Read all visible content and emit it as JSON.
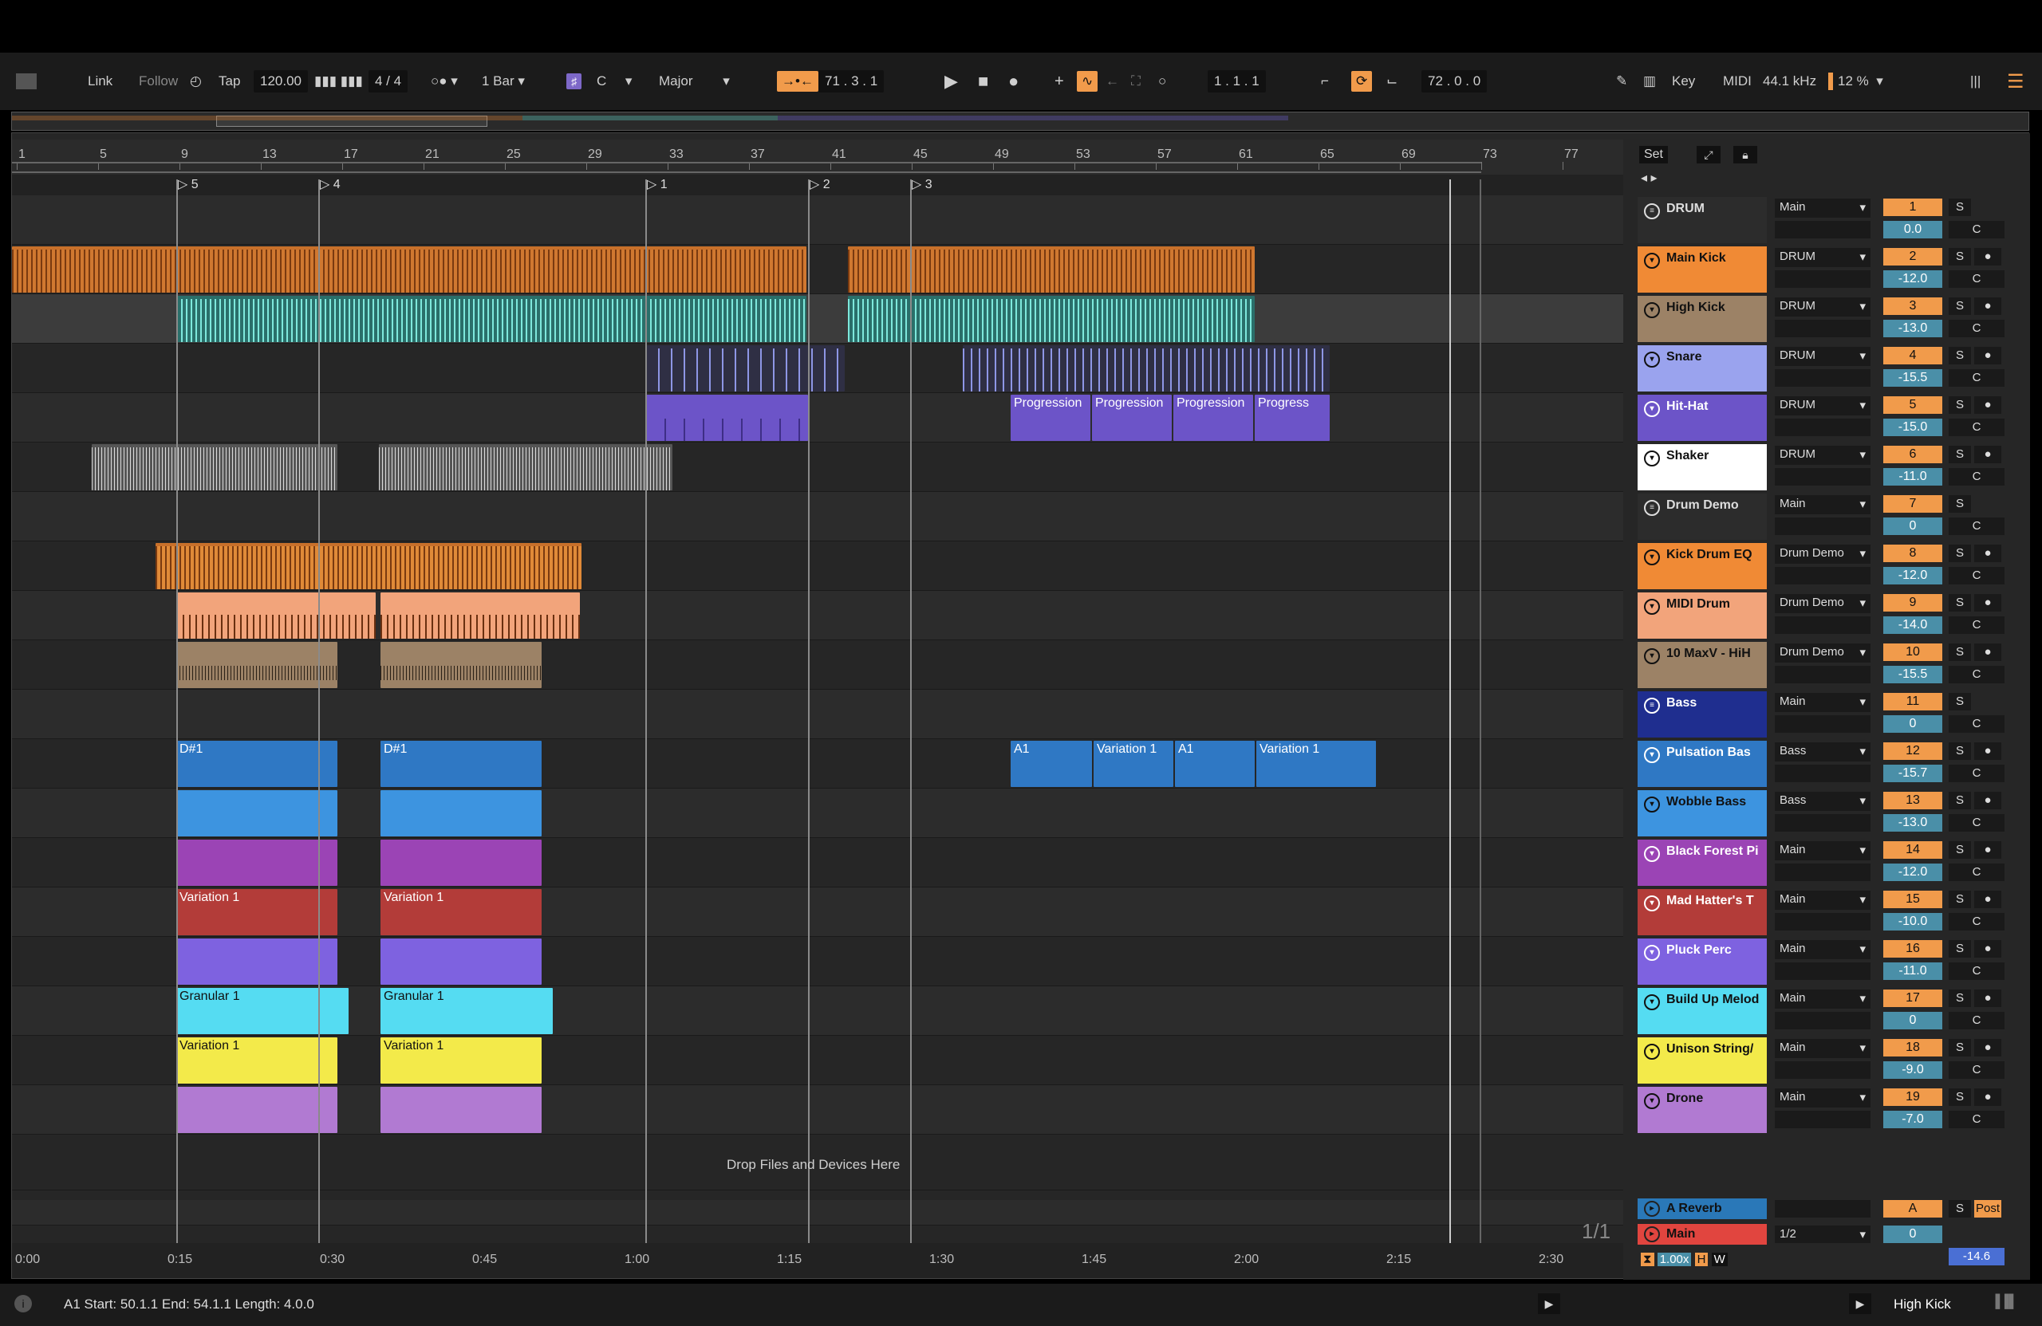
{
  "toolbar": {
    "link": "Link",
    "follow": "Follow",
    "tap": "Tap",
    "tempo": "120.00",
    "signature": "4 / 4",
    "quantize": "1 Bar",
    "key_root": "C",
    "scale": "Major",
    "position": "71 .  3 .  1",
    "loop_start": "1 .  1 .  1",
    "loop_length": "72 .  0 .  0",
    "key": "Key",
    "midi": "MIDI",
    "sample_rate": "44.1 kHz",
    "cpu": "12 %"
  },
  "ruler": {
    "bars": [
      "1",
      "5",
      "9",
      "13",
      "17",
      "21",
      "25",
      "29",
      "33",
      "37",
      "41",
      "45",
      "49",
      "53",
      "57",
      "61",
      "65",
      "69",
      "73",
      "77"
    ]
  },
  "locators": [
    "5",
    "4",
    "1",
    "2",
    "3"
  ],
  "clips": {
    "prog1": "Progression",
    "prog2": "Progression",
    "prog3": "Progression",
    "prog4": "Progress",
    "d1": "D#1",
    "d2": "D#1",
    "a1": "A1",
    "var_a": "Variation 1",
    "a1b": "A1",
    "var_b": "Variation 1",
    "var1": "Variation 1",
    "var2": "Variation 1",
    "gran1": "Granular 1",
    "gran2": "Granular 1",
    "var3": "Variation 1",
    "var4": "Variation 1"
  },
  "drop_text": "Drop Files and Devices Here",
  "time_ticks": [
    "0:00",
    "0:15",
    "0:30",
    "0:45",
    "1:00",
    "1:15",
    "1:30",
    "1:45",
    "2:00",
    "2:15",
    "2:30"
  ],
  "mixer": {
    "set": "Set",
    "tracks": [
      {
        "name": "DRUM",
        "route": "Main",
        "num": "1",
        "vol": "0.0",
        "color": "#2c2c2c",
        "group": true
      },
      {
        "name": "Main Kick",
        "route": "DRUM",
        "num": "2",
        "vol": "-12.0",
        "color": "#f08a35"
      },
      {
        "name": "High Kick",
        "route": "DRUM",
        "num": "3",
        "vol": "-13.0",
        "color": "#9c8266"
      },
      {
        "name": "Snare",
        "route": "DRUM",
        "num": "4",
        "vol": "-15.5",
        "color": "#9aa3ee"
      },
      {
        "name": "Hit-Hat",
        "route": "DRUM",
        "num": "5",
        "vol": "-15.0",
        "color": "#6c54c8"
      },
      {
        "name": "Shaker",
        "route": "DRUM",
        "num": "6",
        "vol": "-11.0",
        "color": "#ffffff"
      },
      {
        "name": "Drum Demo",
        "route": "Main",
        "num": "7",
        "vol": "0",
        "color": "#2c2c2c",
        "group": true
      },
      {
        "name": "Kick Drum EQ",
        "route": "Drum Demo",
        "num": "8",
        "vol": "-12.0",
        "color": "#f08a35"
      },
      {
        "name": "MIDI Drum",
        "route": "Drum Demo",
        "num": "9",
        "vol": "-14.0",
        "color": "#f2a47b"
      },
      {
        "name": "10 MaxV - HiH",
        "route": "Drum Demo",
        "num": "10",
        "vol": "-15.5",
        "color": "#9c8266"
      },
      {
        "name": "Bass",
        "route": "Main",
        "num": "11",
        "vol": "0",
        "color": "#1f2e8f",
        "group": true
      },
      {
        "name": "Pulsation Bas",
        "route": "Bass",
        "num": "12",
        "vol": "-15.7",
        "color": "#2f78c4"
      },
      {
        "name": "Wobble Bass",
        "route": "Bass",
        "num": "13",
        "vol": "-13.0",
        "color": "#3d94e0"
      },
      {
        "name": "Black Forest Pi",
        "route": "Main",
        "num": "14",
        "vol": "-12.0",
        "color": "#9b44b5"
      },
      {
        "name": "Mad Hatter's T",
        "route": "Main",
        "num": "15",
        "vol": "-10.0",
        "color": "#b33c39"
      },
      {
        "name": "Pluck Perc",
        "route": "Main",
        "num": "16",
        "vol": "-11.0",
        "color": "#7e62e0"
      },
      {
        "name": "Build Up Melod",
        "route": "Main",
        "num": "17",
        "vol": "0",
        "color": "#55dcf2"
      },
      {
        "name": "Unison String/",
        "route": "Main",
        "num": "18",
        "vol": "-9.0",
        "color": "#f3ea4a"
      },
      {
        "name": "Drone",
        "route": "Main",
        "num": "19",
        "vol": "-7.0",
        "color": "#b17ad2"
      }
    ],
    "return_name": "A Reverb",
    "return_letter": "A",
    "return_post": "Post",
    "master_name": "Main",
    "master_route": "1/2",
    "master_vol": "0",
    "master_pan": "-14.6",
    "page": "1/1",
    "zoom": "1.00x"
  },
  "status": {
    "clip_info": "A1  Start: 50.1.1  End: 54.1.1  Length: 4.0.0",
    "selected_track": "High Kick"
  }
}
